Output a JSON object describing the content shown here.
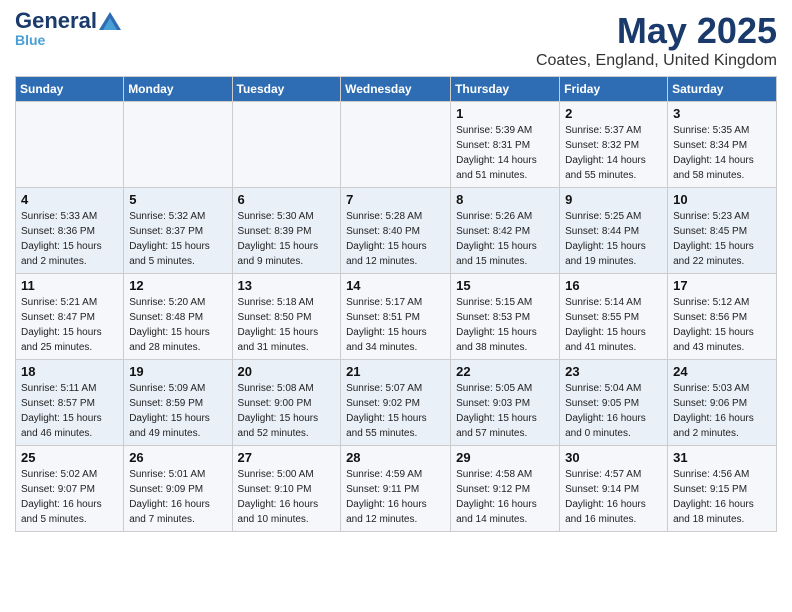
{
  "header": {
    "logo_general": "General",
    "logo_blue": "Blue",
    "title": "May 2025",
    "subtitle": "Coates, England, United Kingdom"
  },
  "days_of_week": [
    "Sunday",
    "Monday",
    "Tuesday",
    "Wednesday",
    "Thursday",
    "Friday",
    "Saturday"
  ],
  "weeks": [
    [
      {
        "day": "",
        "info": ""
      },
      {
        "day": "",
        "info": ""
      },
      {
        "day": "",
        "info": ""
      },
      {
        "day": "",
        "info": ""
      },
      {
        "day": "1",
        "info": "Sunrise: 5:39 AM\nSunset: 8:31 PM\nDaylight: 14 hours\nand 51 minutes."
      },
      {
        "day": "2",
        "info": "Sunrise: 5:37 AM\nSunset: 8:32 PM\nDaylight: 14 hours\nand 55 minutes."
      },
      {
        "day": "3",
        "info": "Sunrise: 5:35 AM\nSunset: 8:34 PM\nDaylight: 14 hours\nand 58 minutes."
      }
    ],
    [
      {
        "day": "4",
        "info": "Sunrise: 5:33 AM\nSunset: 8:36 PM\nDaylight: 15 hours\nand 2 minutes."
      },
      {
        "day": "5",
        "info": "Sunrise: 5:32 AM\nSunset: 8:37 PM\nDaylight: 15 hours\nand 5 minutes."
      },
      {
        "day": "6",
        "info": "Sunrise: 5:30 AM\nSunset: 8:39 PM\nDaylight: 15 hours\nand 9 minutes."
      },
      {
        "day": "7",
        "info": "Sunrise: 5:28 AM\nSunset: 8:40 PM\nDaylight: 15 hours\nand 12 minutes."
      },
      {
        "day": "8",
        "info": "Sunrise: 5:26 AM\nSunset: 8:42 PM\nDaylight: 15 hours\nand 15 minutes."
      },
      {
        "day": "9",
        "info": "Sunrise: 5:25 AM\nSunset: 8:44 PM\nDaylight: 15 hours\nand 19 minutes."
      },
      {
        "day": "10",
        "info": "Sunrise: 5:23 AM\nSunset: 8:45 PM\nDaylight: 15 hours\nand 22 minutes."
      }
    ],
    [
      {
        "day": "11",
        "info": "Sunrise: 5:21 AM\nSunset: 8:47 PM\nDaylight: 15 hours\nand 25 minutes."
      },
      {
        "day": "12",
        "info": "Sunrise: 5:20 AM\nSunset: 8:48 PM\nDaylight: 15 hours\nand 28 minutes."
      },
      {
        "day": "13",
        "info": "Sunrise: 5:18 AM\nSunset: 8:50 PM\nDaylight: 15 hours\nand 31 minutes."
      },
      {
        "day": "14",
        "info": "Sunrise: 5:17 AM\nSunset: 8:51 PM\nDaylight: 15 hours\nand 34 minutes."
      },
      {
        "day": "15",
        "info": "Sunrise: 5:15 AM\nSunset: 8:53 PM\nDaylight: 15 hours\nand 38 minutes."
      },
      {
        "day": "16",
        "info": "Sunrise: 5:14 AM\nSunset: 8:55 PM\nDaylight: 15 hours\nand 41 minutes."
      },
      {
        "day": "17",
        "info": "Sunrise: 5:12 AM\nSunset: 8:56 PM\nDaylight: 15 hours\nand 43 minutes."
      }
    ],
    [
      {
        "day": "18",
        "info": "Sunrise: 5:11 AM\nSunset: 8:57 PM\nDaylight: 15 hours\nand 46 minutes."
      },
      {
        "day": "19",
        "info": "Sunrise: 5:09 AM\nSunset: 8:59 PM\nDaylight: 15 hours\nand 49 minutes."
      },
      {
        "day": "20",
        "info": "Sunrise: 5:08 AM\nSunset: 9:00 PM\nDaylight: 15 hours\nand 52 minutes."
      },
      {
        "day": "21",
        "info": "Sunrise: 5:07 AM\nSunset: 9:02 PM\nDaylight: 15 hours\nand 55 minutes."
      },
      {
        "day": "22",
        "info": "Sunrise: 5:05 AM\nSunset: 9:03 PM\nDaylight: 15 hours\nand 57 minutes."
      },
      {
        "day": "23",
        "info": "Sunrise: 5:04 AM\nSunset: 9:05 PM\nDaylight: 16 hours\nand 0 minutes."
      },
      {
        "day": "24",
        "info": "Sunrise: 5:03 AM\nSunset: 9:06 PM\nDaylight: 16 hours\nand 2 minutes."
      }
    ],
    [
      {
        "day": "25",
        "info": "Sunrise: 5:02 AM\nSunset: 9:07 PM\nDaylight: 16 hours\nand 5 minutes."
      },
      {
        "day": "26",
        "info": "Sunrise: 5:01 AM\nSunset: 9:09 PM\nDaylight: 16 hours\nand 7 minutes."
      },
      {
        "day": "27",
        "info": "Sunrise: 5:00 AM\nSunset: 9:10 PM\nDaylight: 16 hours\nand 10 minutes."
      },
      {
        "day": "28",
        "info": "Sunrise: 4:59 AM\nSunset: 9:11 PM\nDaylight: 16 hours\nand 12 minutes."
      },
      {
        "day": "29",
        "info": "Sunrise: 4:58 AM\nSunset: 9:12 PM\nDaylight: 16 hours\nand 14 minutes."
      },
      {
        "day": "30",
        "info": "Sunrise: 4:57 AM\nSunset: 9:14 PM\nDaylight: 16 hours\nand 16 minutes."
      },
      {
        "day": "31",
        "info": "Sunrise: 4:56 AM\nSunset: 9:15 PM\nDaylight: 16 hours\nand 18 minutes."
      }
    ]
  ]
}
